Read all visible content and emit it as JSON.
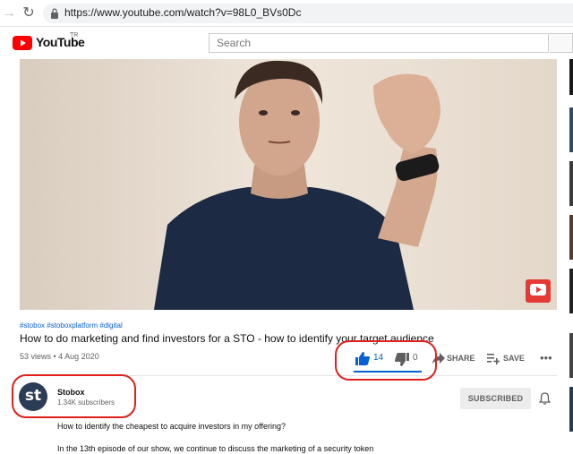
{
  "browser": {
    "url": "https://www.youtube.com/watch?v=98L0_BVs0Dc"
  },
  "header": {
    "wordmark": "YouTube",
    "region": "TR",
    "search_placeholder": "Search"
  },
  "video": {
    "hashtags": "#stobox #stoboxplatform #digital",
    "title": "How to do marketing and find investors for a STO - how to identify your target audience",
    "views_date": "53 views • 4 Aug 2020",
    "likes": "14",
    "dislikes": "0",
    "like_ratio": 1.0,
    "share_label": "SHARE",
    "save_label": "SAVE"
  },
  "channel": {
    "avatar_text": "st",
    "name": "Stobox",
    "subscribers": "1.34K subscribers",
    "subscribed_label": "SUBSCRIBED"
  },
  "description": {
    "line1": "How to identify the cheapest to acquire investors in my offering?",
    "line2": "In the 13th episode of our show, we continue to discuss the marketing of a security token"
  },
  "colors": {
    "brand_red": "#ff0000",
    "link_blue": "#065fd4",
    "annotation_red": "#e0201c"
  }
}
